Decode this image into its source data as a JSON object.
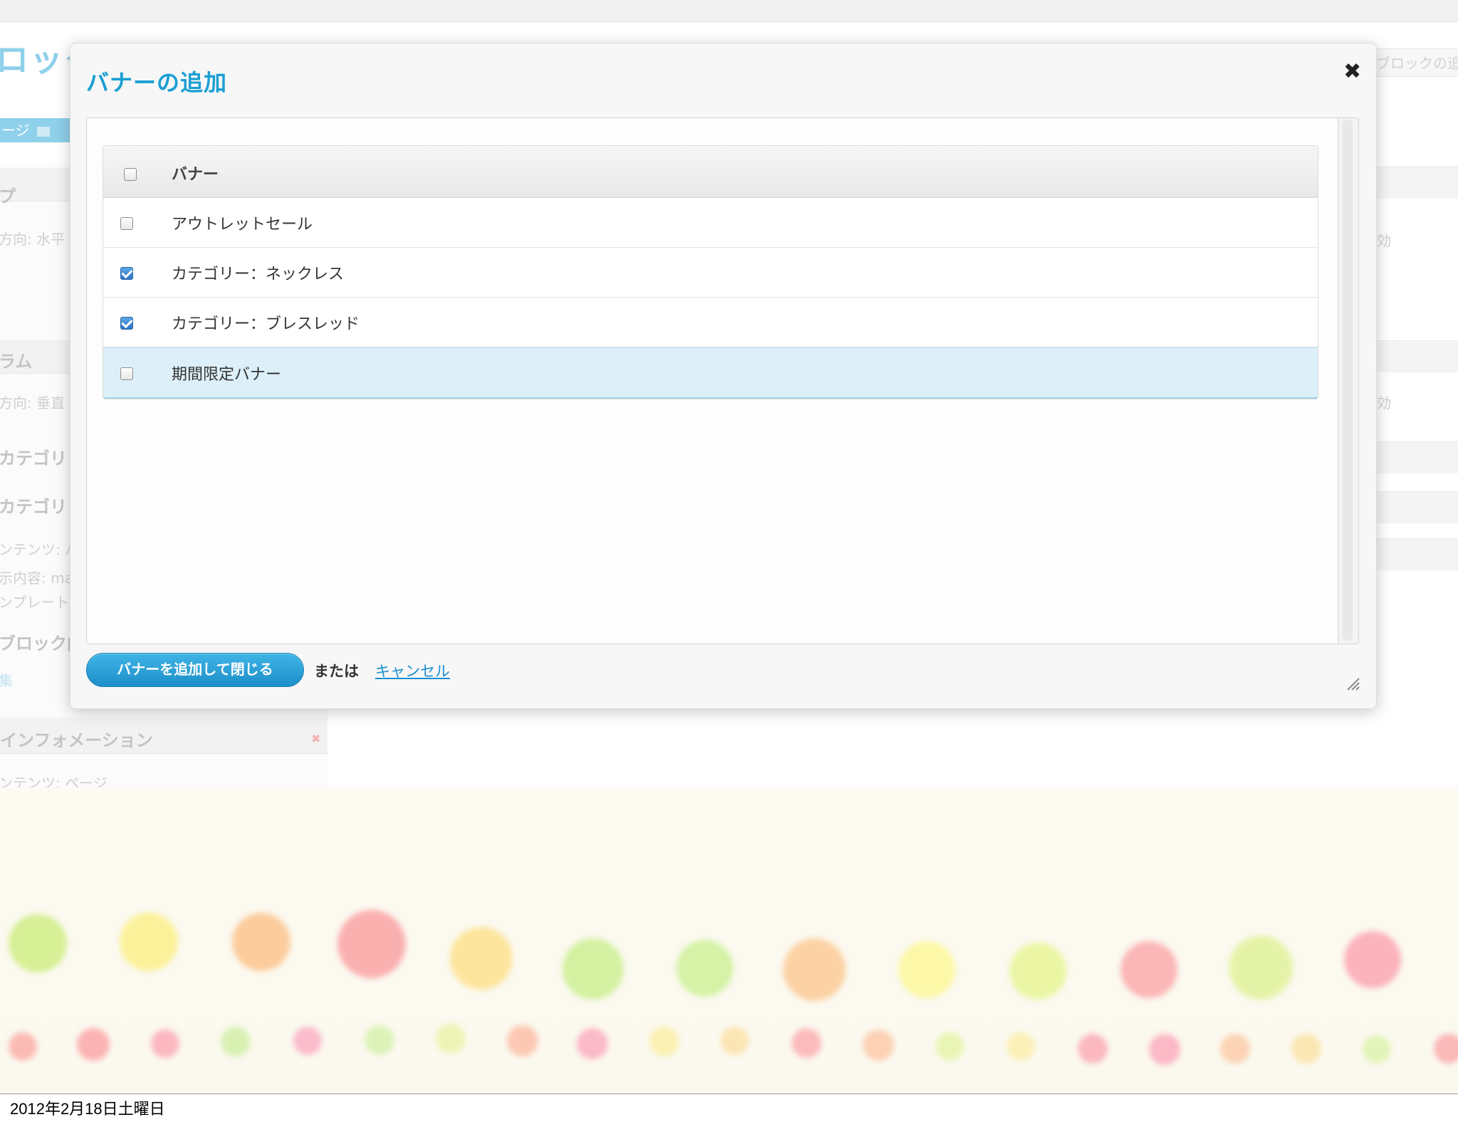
{
  "background_page": {
    "title_fragment": "ロック",
    "tab_label": "ージ",
    "right_button": "ブロックの追",
    "sections": [
      {
        "label": "プ",
        "sub": "方向: 水平"
      },
      {
        "label": "ラム",
        "sub": "方向: 垂直"
      },
      {
        "label": "カテゴリ・",
        "sub": ""
      },
      {
        "label": "カテゴリ・",
        "sub": ""
      }
    ],
    "details": [
      "ンテンツ: バ",
      "示内容: man",
      "ンプレート: "
    ],
    "block_label": "ブロック内",
    "link_fragment": "集",
    "info_title": "インフォメーション",
    "info_sub": "ンテンツ: ページ",
    "right_status": [
      "効",
      "効"
    ]
  },
  "modal": {
    "title": "バナーの追加",
    "close_label": "✖",
    "table": {
      "header": "バナー",
      "rows": [
        {
          "label": "アウトレットセール",
          "checked": false,
          "highlighted": false
        },
        {
          "label": "カテゴリー：ネックレス",
          "checked": true,
          "highlighted": false
        },
        {
          "label": "カテゴリー：ブレスレッド",
          "checked": true,
          "highlighted": false
        },
        {
          "label": "期間限定バナー",
          "checked": false,
          "highlighted": true
        }
      ]
    },
    "footer": {
      "submit_label": "バナーを追加して閉じる",
      "or_label": "または",
      "cancel_label": "キャンセル"
    }
  },
  "slide_footer": {
    "date": "2012年2月18日土曜日"
  },
  "colors": {
    "accent": "#1a9fd3",
    "button": "#2aa3db",
    "highlight_row": "#ddf0f9",
    "checkbox_checked": "#2a74c4"
  }
}
